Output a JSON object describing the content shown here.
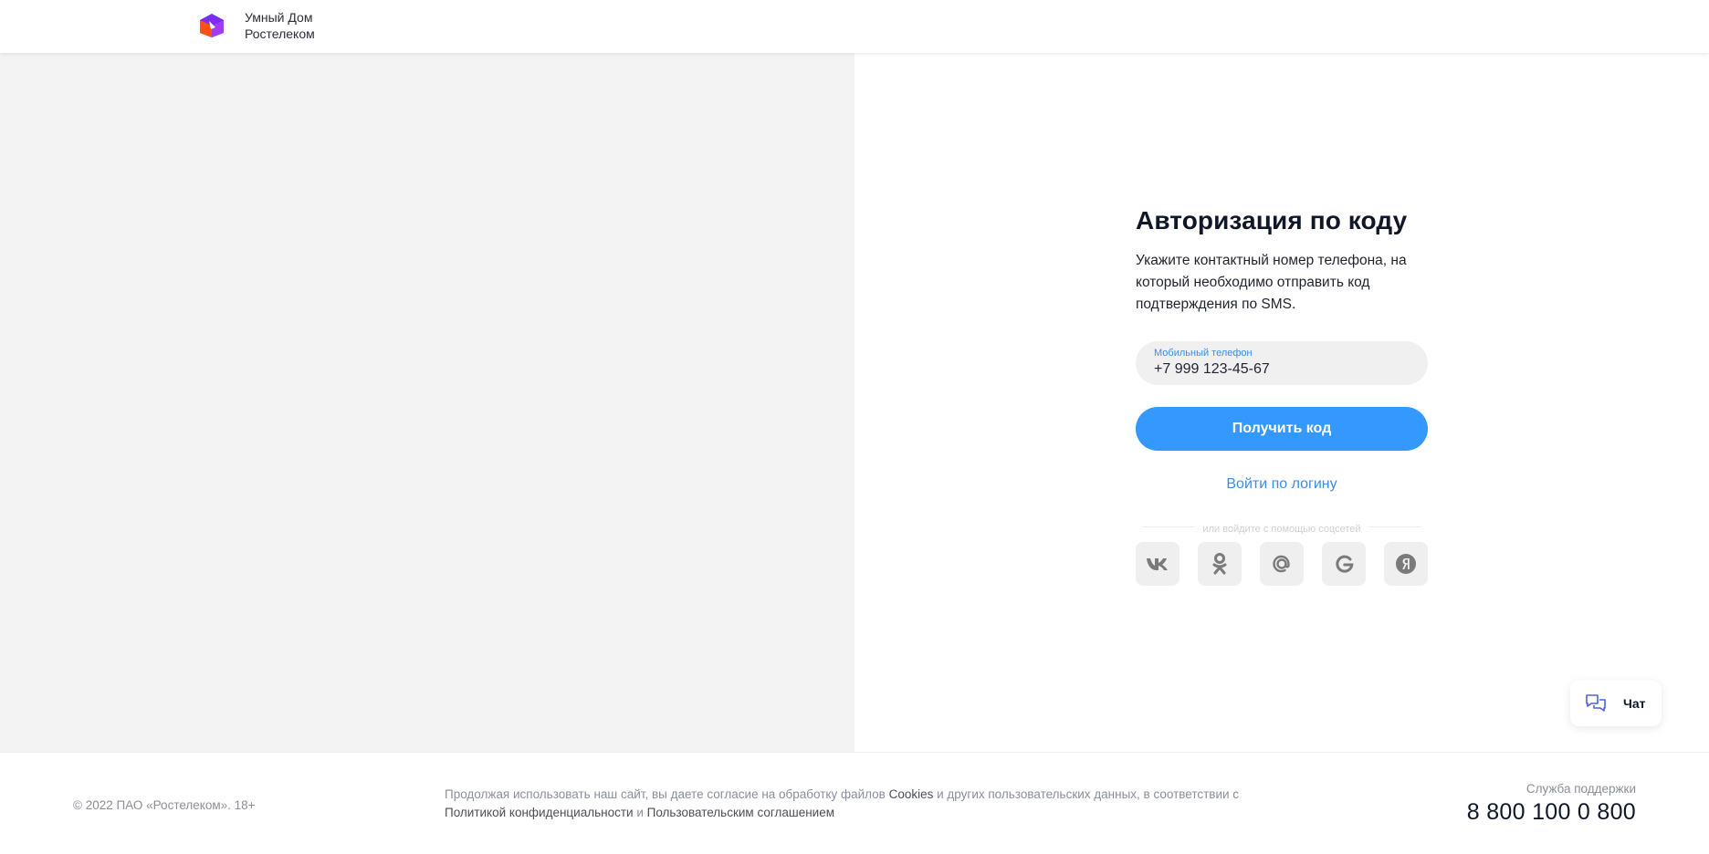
{
  "header": {
    "brand_line1": "Умный Дом",
    "brand_line2": "Ростелеком",
    "logo_icon": "rostelecom-logo"
  },
  "auth": {
    "title": "Авторизация по коду",
    "description": "Укажите контактный номер телефона, на который необходимо отправить код подтверждения по SMS.",
    "phone_label": "Мобильный телефон",
    "phone_value": "+7 999 123-45-67",
    "submit_label": "Получить код",
    "login_link": "Войти по логину",
    "divider_text": "или войдите с помощью соцсетей",
    "socials": [
      {
        "name": "vk-icon"
      },
      {
        "name": "odnoklassniki-icon"
      },
      {
        "name": "mail-ru-icon"
      },
      {
        "name": "google-icon"
      },
      {
        "name": "yandex-icon"
      }
    ]
  },
  "chat": {
    "label": "Чат",
    "icon": "chat-icon"
  },
  "footer": {
    "copyright": "© 2022 ПАО «Ростелеком». 18+",
    "consent_before_cookies": "Продолжая использовать наш сайт, вы даете согласие на обработку файлов ",
    "cookies_link": "Cookies",
    "consent_after_cookies": " и других пользовательских данных, в соответствии с ",
    "privacy_link": "Политикой конфиденциальности",
    "conjunction": " и ",
    "agreement_link": "Пользовательским соглашением",
    "support_label": "Служба поддержки",
    "support_phone": "8 800 100 0 800"
  },
  "colors": {
    "accent": "#3399ff",
    "link": "#3a8ee6",
    "left_panel": "#f3f3f3",
    "logo_purple": "#7b2cf5",
    "logo_orange": "#ff4f12"
  }
}
